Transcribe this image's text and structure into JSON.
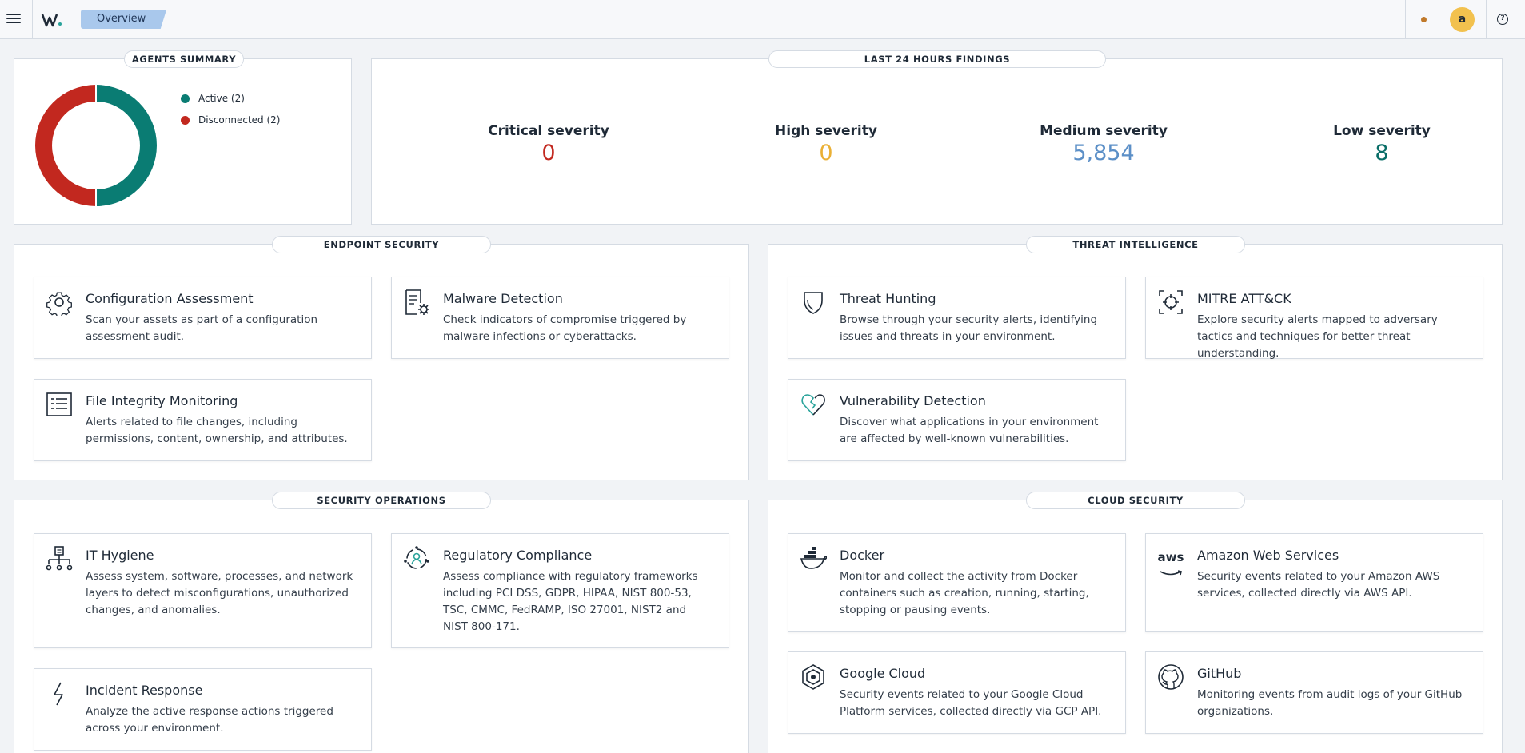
{
  "header": {
    "breadcrumb": "Overview",
    "user_initial": "a",
    "help_symbol": "?"
  },
  "agents_summary": {
    "title": "AGENTS SUMMARY",
    "legend": [
      {
        "label": "Active (2)",
        "color": "#0a7c73"
      },
      {
        "label": "Disconnected (2)",
        "color": "#c2281f"
      }
    ]
  },
  "findings": {
    "title": "LAST 24 HOURS FINDINGS",
    "items": [
      {
        "label": "Critical severity",
        "value": "0",
        "color": "#c2281f"
      },
      {
        "label": "High severity",
        "value": "0",
        "color": "#eab035"
      },
      {
        "label": "Medium severity",
        "value": "5,854",
        "color": "#5b8fc7"
      },
      {
        "label": "Low severity",
        "value": "8",
        "color": "#0a6e68"
      }
    ]
  },
  "sections": {
    "endpoint": {
      "title": "ENDPOINT SECURITY",
      "cards": [
        {
          "title": "Configuration Assessment",
          "desc": "Scan your assets as part of a configuration assessment audit.",
          "icon": "gear-icon"
        },
        {
          "title": "Malware Detection",
          "desc": "Check indicators of compromise triggered by malware infections or cyberattacks.",
          "icon": "document-gear-icon"
        },
        {
          "title": "File Integrity Monitoring",
          "desc": "Alerts related to file changes, including permissions, content, ownership, and attributes.",
          "icon": "list-document-icon"
        }
      ]
    },
    "threat": {
      "title": "THREAT INTELLIGENCE",
      "cards": [
        {
          "title": "Threat Hunting",
          "desc": "Browse through your security alerts, identifying issues and threats in your environment.",
          "icon": "shield-icon"
        },
        {
          "title": "MITRE ATT&CK",
          "desc": "Explore security alerts mapped to adversary tactics and techniques for better threat understanding.",
          "icon": "crosshair-icon"
        },
        {
          "title": "Vulnerability Detection",
          "desc": "Discover what applications in your environment are affected by well-known vulnerabilities.",
          "icon": "broken-heart-icon"
        }
      ]
    },
    "secops": {
      "title": "SECURITY OPERATIONS",
      "cards": [
        {
          "title": "IT Hygiene",
          "desc": "Assess system, software, processes, and network layers to detect misconfigurations, unauthorized changes, and anomalies.",
          "icon": "hierarchy-icon"
        },
        {
          "title": "Regulatory Compliance",
          "desc": "Assess compliance with regulatory frameworks including PCI DSS, GDPR, HIPAA, NIST 800-53, TSC, CMMC, FedRAMP, ISO 27001, NIST2 and NIST 800-171.",
          "icon": "compliance-user-icon"
        },
        {
          "title": "Incident Response",
          "desc": "Analyze the active response actions triggered across your environment.",
          "icon": "lightning-icon"
        }
      ]
    },
    "cloud": {
      "title": "CLOUD SECURITY",
      "cards": [
        {
          "title": "Docker",
          "desc": "Monitor and collect the activity from Docker containers such as creation, running, starting, stopping or pausing events.",
          "icon": "docker-icon"
        },
        {
          "title": "Amazon Web Services",
          "desc": "Security events related to your Amazon AWS services, collected directly via AWS API.",
          "icon": "aws-icon",
          "icon_text": "aws"
        },
        {
          "title": "Google Cloud",
          "desc": "Security events related to your Google Cloud Platform services, collected directly via GCP API.",
          "icon": "google-cloud-icon"
        },
        {
          "title": "GitHub",
          "desc": "Monitoring events from audit logs of your GitHub organizations.",
          "icon": "github-icon"
        }
      ]
    }
  }
}
